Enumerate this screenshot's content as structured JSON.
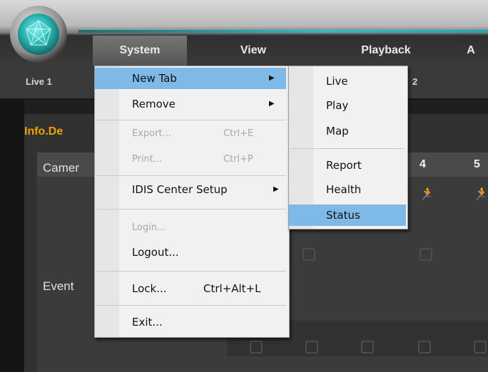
{
  "menubar": {
    "items": [
      {
        "label": "System",
        "active": true
      },
      {
        "label": "View",
        "active": false
      },
      {
        "label": "Playback",
        "active": false
      },
      {
        "label": "A",
        "active": false
      }
    ]
  },
  "tabs": {
    "live1": "Live 1",
    "partial": "2"
  },
  "panel": {
    "title": "Info.De",
    "camera_label": "Camer",
    "event_label": "Event",
    "columns": [
      "4",
      "5"
    ]
  },
  "system_menu": {
    "items": [
      {
        "label": "New Tab",
        "shortcut": "",
        "submenu": true,
        "disabled": false,
        "highlighted": true
      },
      {
        "label": "Remove",
        "shortcut": "",
        "submenu": true,
        "disabled": false,
        "highlighted": false
      },
      {
        "label": "Export...",
        "shortcut": "Ctrl+E",
        "submenu": false,
        "disabled": true,
        "highlighted": false
      },
      {
        "label": "Print...",
        "shortcut": "Ctrl+P",
        "submenu": false,
        "disabled": true,
        "highlighted": false
      },
      {
        "label": "IDIS Center Setup",
        "shortcut": "",
        "submenu": true,
        "disabled": false,
        "highlighted": false
      },
      {
        "label": "Login...",
        "shortcut": "",
        "submenu": false,
        "disabled": true,
        "highlighted": false
      },
      {
        "label": "Logout...",
        "shortcut": "",
        "submenu": false,
        "disabled": false,
        "highlighted": false
      },
      {
        "label": "Lock...",
        "shortcut": "Ctrl+Alt+L",
        "submenu": false,
        "disabled": false,
        "highlighted": false
      },
      {
        "label": "Exit...",
        "shortcut": "",
        "submenu": false,
        "disabled": false,
        "highlighted": false
      }
    ]
  },
  "newtab_menu": {
    "items": [
      {
        "label": "Live",
        "highlighted": false
      },
      {
        "label": "Play",
        "highlighted": false
      },
      {
        "label": "Map",
        "highlighted": false
      },
      {
        "label": "Report",
        "highlighted": false
      },
      {
        "label": "Health",
        "highlighted": false
      },
      {
        "label": "Status",
        "highlighted": true
      }
    ]
  },
  "colors": {
    "highlight": "#7fb9e8",
    "accent_teal": "#36b8c0",
    "title_orange": "#f0a000"
  }
}
